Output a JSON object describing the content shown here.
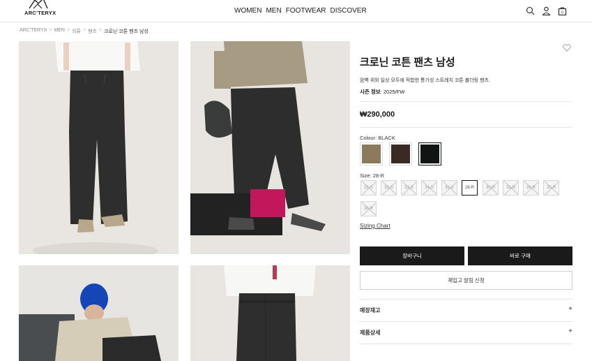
{
  "header": {
    "logo_text": "ARC'TERYX",
    "nav": [
      "WOMEN",
      "MEN",
      "FOOTWEAR",
      "DISCOVER"
    ],
    "icons": [
      "search-icon",
      "user-icon",
      "bag-icon"
    ]
  },
  "breadcrumb": [
    "ARC'TERYX",
    "MEN",
    "의류",
    "팬츠",
    "크로닌 코튼 팬츠 남성"
  ],
  "product": {
    "title": "크로닌 코튼 팬츠 남성",
    "description": "암벽 위와 일상 모두에 적합한 통기성 스트레치 코튼 볼더링 팬츠.",
    "season_label": "시즌 정보",
    "season_value": ": 2025/FW",
    "price": "₩290,000",
    "colour_label": "Colour: BLACK",
    "colours": [
      {
        "name": "tan",
        "hex": "#8c7a5c"
      },
      {
        "name": "dark-brown",
        "hex": "#3a2a26"
      },
      {
        "name": "black",
        "hex": "#111512"
      }
    ],
    "selected_colour": "black",
    "size_label": "Size: 28-R",
    "sizes": [
      "28-S",
      "30-S",
      "32-S",
      "34-S",
      "36-S",
      "28-R",
      "30-R",
      "32-R",
      "34-R",
      "36-R",
      "38-R"
    ],
    "selected_size": "28-R",
    "size_chart": "Sizing Chart",
    "add_to_cart": "장바구니",
    "buy_now": "바로 구매",
    "restock": "재입고 알림 신청",
    "accordions": [
      "매장재고",
      "제품상세"
    ]
  }
}
